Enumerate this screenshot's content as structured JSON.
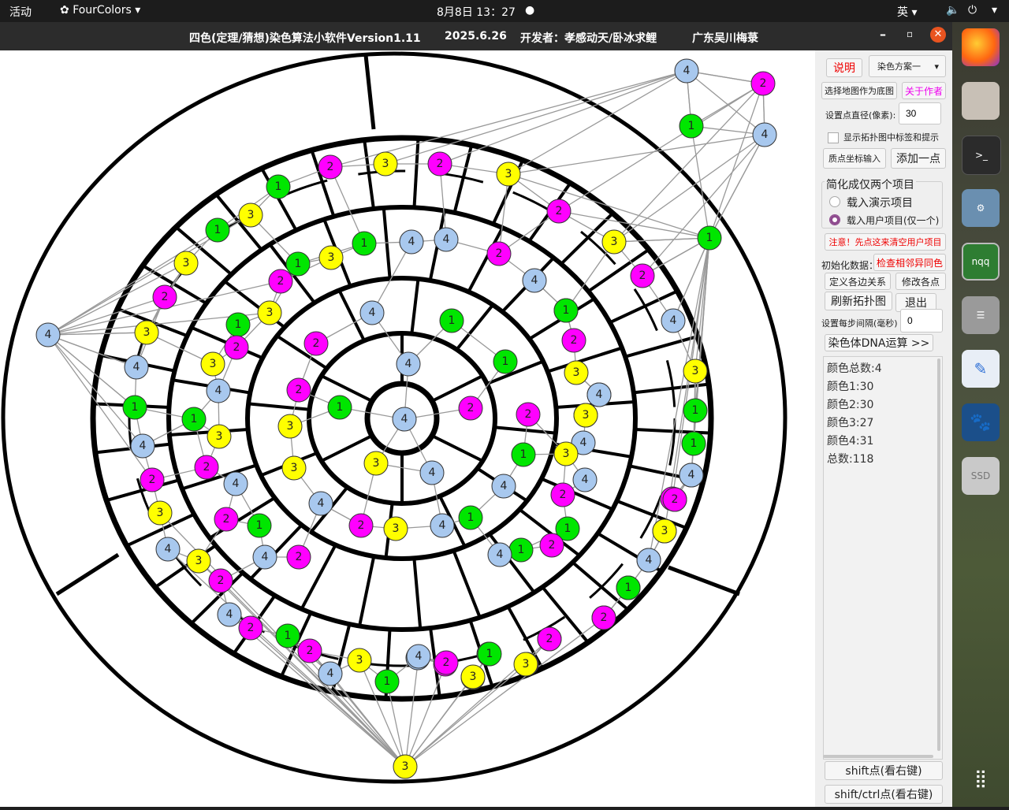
{
  "topbar": {
    "activities": "活动",
    "app_menu": "FourColors",
    "clock": "8月8日  13：27",
    "input_method": "英"
  },
  "window": {
    "title": "四色(定理/猜想)染色算法小软件Version1.11",
    "date": "2025.6.26",
    "developer": "开发者：孝感动天/卧冰求鲤",
    "place": "广东吴川梅菉"
  },
  "panel": {
    "explain": "说明",
    "scheme_select": "染色方案一",
    "choose_map": "选择地图作为底图",
    "about_author": "关于作者",
    "diameter_label": "设置点直径(像素):",
    "diameter_value": "30",
    "show_labels": "显示拓扑图中标签和提示",
    "point_coord_input": "质点坐标输入",
    "add_point": "添加一点",
    "simplify_group": "简化成仅两个项目",
    "load_demo": "载入演示项目",
    "load_user": "载入用户项目(仅一个)",
    "warning": "注意！先点这来清空用户项目",
    "init_data": "初始化数据：",
    "check_adjacent": "检查相邻异同色",
    "define_edges": "定义各边关系",
    "modify_points": "修改各点",
    "refresh_topology": "刷新拓扑图",
    "exit": "退出",
    "step_interval_label": "设置每步间隔(毫秒)",
    "step_interval_value": "0",
    "dna_run": "染色体DNA运算 >>",
    "stats": [
      "颜色总数:4",
      "颜色1:30",
      "颜色2:30",
      "颜色3:27",
      "颜色4:31",
      "总数:118"
    ],
    "shift_point": "shift点(看右键)",
    "shift_ctrl_point": "shift/ctrl点(看右键)"
  },
  "dock": [
    "firefox-icon",
    "files-icon",
    "terminal-icon",
    "settings-icon",
    "nqq-icon",
    "database-icon",
    "text-editor-icon",
    "paw-icon",
    "ssd-icon",
    "app-grid-icon"
  ],
  "colors": {
    "1": "#00e600",
    "2": "#ff00ff",
    "3": "#ffff00",
    "4": "#a8c8ee"
  },
  "graph": {
    "nodes": [
      {
        "id": "a1",
        "label": "4"
      },
      {
        "id": "a2",
        "label": "2"
      },
      {
        "id": "a3",
        "label": "1"
      },
      {
        "id": "a4",
        "label": "4"
      },
      {
        "id": "a5",
        "label": "1"
      },
      {
        "id": "b1",
        "label": "2"
      },
      {
        "id": "b2",
        "label": "3"
      },
      {
        "id": "b3",
        "label": "2"
      },
      {
        "id": "b4",
        "label": "3"
      },
      {
        "id": "b5",
        "label": "2"
      },
      {
        "id": "b6",
        "label": "3"
      },
      {
        "id": "b7",
        "label": "2"
      },
      {
        "id": "b8",
        "label": "4"
      },
      {
        "id": "b9",
        "label": "3"
      },
      {
        "id": "b10",
        "label": "1"
      },
      {
        "id": "b11",
        "label": "2"
      },
      {
        "id": "b12",
        "label": "1"
      },
      {
        "id": "b13",
        "label": "3"
      },
      {
        "id": "b14",
        "label": "4"
      },
      {
        "id": "c1",
        "label": "1"
      },
      {
        "id": "c2",
        "label": "3"
      },
      {
        "id": "c3",
        "label": "3"
      },
      {
        "id": "c4",
        "label": "1"
      },
      {
        "id": "c5",
        "label": "4"
      },
      {
        "id": "c6",
        "label": "2"
      },
      {
        "id": "c7",
        "label": "4"
      },
      {
        "id": "c8",
        "label": "1"
      },
      {
        "id": "c9",
        "label": "2"
      },
      {
        "id": "c10",
        "label": "3"
      },
      {
        "id": "c11",
        "label": "4"
      },
      {
        "id": "c12",
        "label": "3"
      },
      {
        "id": "c13",
        "label": "1"
      },
      {
        "id": "c14",
        "label": "3"
      },
      {
        "id": "c15",
        "label": "4"
      },
      {
        "id": "c16",
        "label": "1"
      },
      {
        "id": "c17",
        "label": "4"
      },
      {
        "id": "c18",
        "label": "2"
      },
      {
        "id": "c19",
        "label": "3"
      },
      {
        "id": "c20",
        "label": "1"
      },
      {
        "id": "c21",
        "label": "2"
      },
      {
        "id": "c22",
        "label": "4"
      },
      {
        "id": "c23",
        "label": "3"
      },
      {
        "id": "c24",
        "label": "2"
      },
      {
        "id": "c25",
        "label": "4"
      },
      {
        "id": "d1",
        "label": "4"
      },
      {
        "id": "d2",
        "label": "2"
      },
      {
        "id": "d3",
        "label": "3"
      },
      {
        "id": "d4",
        "label": "4"
      },
      {
        "id": "d5",
        "label": "1"
      },
      {
        "id": "d6",
        "label": "4"
      },
      {
        "id": "d7",
        "label": "2"
      },
      {
        "id": "d8",
        "label": "3"
      },
      {
        "id": "d9",
        "label": "4"
      },
      {
        "id": "d10",
        "label": "3"
      },
      {
        "id": "d11",
        "label": "2"
      },
      {
        "id": "d12",
        "label": "4"
      },
      {
        "id": "d13",
        "label": "2"
      },
      {
        "id": "d14",
        "label": "1"
      },
      {
        "id": "d15",
        "label": "2"
      },
      {
        "id": "d16",
        "label": "4"
      },
      {
        "id": "d17",
        "label": "3"
      },
      {
        "id": "d18",
        "label": "1"
      },
      {
        "id": "d19",
        "label": "4"
      },
      {
        "id": "d20",
        "label": "2"
      },
      {
        "id": "d21",
        "label": "3"
      },
      {
        "id": "d22",
        "label": "1"
      },
      {
        "id": "d23",
        "label": "3"
      },
      {
        "id": "d24",
        "label": "2"
      },
      {
        "id": "d25",
        "label": "2"
      },
      {
        "id": "d26",
        "label": "1"
      },
      {
        "id": "d27",
        "label": "4"
      },
      {
        "id": "d28",
        "label": "3"
      },
      {
        "id": "d29",
        "label": "2"
      },
      {
        "id": "d30",
        "label": "4"
      },
      {
        "id": "e1",
        "label": "2"
      },
      {
        "id": "e2",
        "label": "1"
      },
      {
        "id": "e3",
        "label": "3"
      },
      {
        "id": "e4",
        "label": "1"
      },
      {
        "id": "e5",
        "label": "2"
      },
      {
        "id": "e6",
        "label": "3"
      },
      {
        "id": "e7",
        "label": "4"
      },
      {
        "id": "e8",
        "label": "1"
      },
      {
        "id": "e9",
        "label": "3"
      },
      {
        "id": "e10",
        "label": "2"
      },
      {
        "id": "e11",
        "label": "4"
      },
      {
        "id": "e12",
        "label": "2"
      },
      {
        "id": "e13",
        "label": "1"
      },
      {
        "id": "e14",
        "label": "4"
      },
      {
        "id": "e15",
        "label": "2"
      },
      {
        "id": "f1",
        "label": "4"
      },
      {
        "id": "f2",
        "label": "1"
      },
      {
        "id": "f3",
        "label": "2"
      },
      {
        "id": "f4",
        "label": "4"
      },
      {
        "id": "f5",
        "label": "1"
      },
      {
        "id": "f6",
        "label": "2"
      },
      {
        "id": "f7",
        "label": "1"
      },
      {
        "id": "f8",
        "label": "2"
      },
      {
        "id": "f9",
        "label": "4"
      },
      {
        "id": "f10",
        "label": "2"
      },
      {
        "id": "f11",
        "label": "3"
      },
      {
        "id": "f12",
        "label": "4"
      },
      {
        "id": "f13",
        "label": "3"
      },
      {
        "id": "f14",
        "label": "4"
      },
      {
        "id": "f15",
        "label": "1"
      },
      {
        "id": "g1",
        "label": "3"
      },
      {
        "id": "g2",
        "label": "4"
      },
      {
        "id": "g3",
        "label": "1"
      },
      {
        "id": "g4",
        "label": "3"
      },
      {
        "id": "g5",
        "label": "4"
      },
      {
        "id": "g6",
        "label": "4"
      },
      {
        "id": "g7",
        "label": "3"
      },
      {
        "id": "g8",
        "label": "2"
      },
      {
        "id": "g9",
        "label": "3"
      },
      {
        "id": "g10",
        "label": "4"
      },
      {
        "id": "g11",
        "label": "1"
      },
      {
        "id": "g12",
        "label": "2"
      },
      {
        "id": "g13",
        "label": "4"
      },
      {
        "id": "g14",
        "label": "1"
      },
      {
        "id": "g15",
        "label": "2"
      },
      {
        "id": "g16",
        "label": "1"
      },
      {
        "id": "g17",
        "label": "4"
      },
      {
        "id": "g18",
        "label": "3"
      }
    ]
  }
}
